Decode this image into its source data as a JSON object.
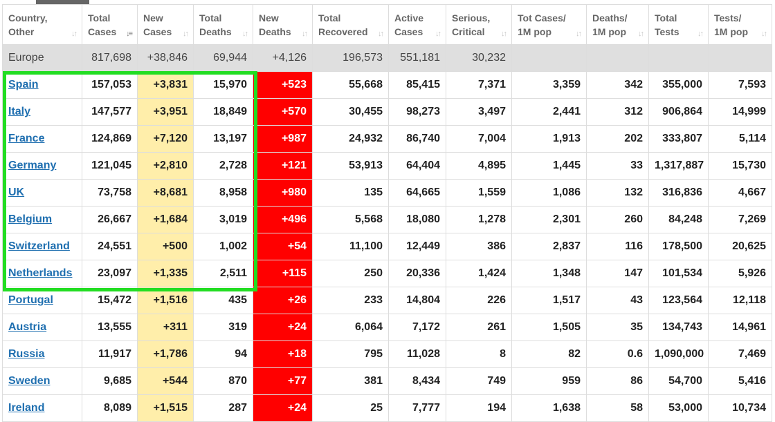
{
  "columns": [
    {
      "line1": "Country,",
      "line2": "Other",
      "sort_active": false
    },
    {
      "line1": "Total",
      "line2": "Cases",
      "sort_active": true
    },
    {
      "line1": "New",
      "line2": "Cases",
      "sort_active": false
    },
    {
      "line1": "Total",
      "line2": "Deaths",
      "sort_active": false
    },
    {
      "line1": "New",
      "line2": "Deaths",
      "sort_active": false
    },
    {
      "line1": "Total",
      "line2": "Recovered",
      "sort_active": false
    },
    {
      "line1": "Active",
      "line2": "Cases",
      "sort_active": false
    },
    {
      "line1": "Serious,",
      "line2": "Critical",
      "sort_active": false
    },
    {
      "line1": "Tot Cases/",
      "line2": "1M pop",
      "sort_active": false
    },
    {
      "line1": "Deaths/",
      "line2": "1M pop",
      "sort_active": false
    },
    {
      "line1": "Total",
      "line2": "Tests",
      "sort_active": false
    },
    {
      "line1": "Tests/",
      "line2": "1M pop",
      "sort_active": false
    }
  ],
  "continent_row": {
    "name": "Europe",
    "cells": [
      "817,698",
      "+38,846",
      "69,944",
      "+4,126",
      "196,573",
      "551,181",
      "30,232",
      "",
      "",
      "",
      ""
    ]
  },
  "rows": [
    {
      "name": "Spain",
      "cells": [
        "157,053",
        "+3,831",
        "15,970",
        "+523",
        "55,668",
        "85,415",
        "7,371",
        "3,359",
        "342",
        "355,000",
        "7,593"
      ]
    },
    {
      "name": "Italy",
      "cells": [
        "147,577",
        "+3,951",
        "18,849",
        "+570",
        "30,455",
        "98,273",
        "3,497",
        "2,441",
        "312",
        "906,864",
        "14,999"
      ]
    },
    {
      "name": "France",
      "cells": [
        "124,869",
        "+7,120",
        "13,197",
        "+987",
        "24,932",
        "86,740",
        "7,004",
        "1,913",
        "202",
        "333,807",
        "5,114"
      ]
    },
    {
      "name": "Germany",
      "cells": [
        "121,045",
        "+2,810",
        "2,728",
        "+121",
        "53,913",
        "64,404",
        "4,895",
        "1,445",
        "33",
        "1,317,887",
        "15,730"
      ]
    },
    {
      "name": "UK",
      "cells": [
        "73,758",
        "+8,681",
        "8,958",
        "+980",
        "135",
        "64,665",
        "1,559",
        "1,086",
        "132",
        "316,836",
        "4,667"
      ]
    },
    {
      "name": "Belgium",
      "cells": [
        "26,667",
        "+1,684",
        "3,019",
        "+496",
        "5,568",
        "18,080",
        "1,278",
        "2,301",
        "260",
        "84,248",
        "7,269"
      ]
    },
    {
      "name": "Switzerland",
      "cells": [
        "24,551",
        "+500",
        "1,002",
        "+54",
        "11,100",
        "12,449",
        "386",
        "2,837",
        "116",
        "178,500",
        "20,625"
      ]
    },
    {
      "name": "Netherlands",
      "cells": [
        "23,097",
        "+1,335",
        "2,511",
        "+115",
        "250",
        "20,336",
        "1,424",
        "1,348",
        "147",
        "101,534",
        "5,926"
      ]
    },
    {
      "name": "Portugal",
      "cells": [
        "15,472",
        "+1,516",
        "435",
        "+26",
        "233",
        "14,804",
        "226",
        "1,517",
        "43",
        "123,564",
        "12,118"
      ]
    },
    {
      "name": "Austria",
      "cells": [
        "13,555",
        "+311",
        "319",
        "+24",
        "6,064",
        "7,172",
        "261",
        "1,505",
        "35",
        "134,743",
        "14,961"
      ]
    },
    {
      "name": "Russia",
      "cells": [
        "11,917",
        "+1,786",
        "94",
        "+18",
        "795",
        "11,028",
        "8",
        "82",
        "0.6",
        "1,090,000",
        "7,469"
      ]
    },
    {
      "name": "Sweden",
      "cells": [
        "9,685",
        "+544",
        "870",
        "+77",
        "381",
        "8,434",
        "749",
        "959",
        "86",
        "54,700",
        "5,416"
      ]
    },
    {
      "name": "Ireland",
      "cells": [
        "8,089",
        "+1,515",
        "287",
        "+24",
        "25",
        "7,777",
        "194",
        "1,638",
        "58",
        "53,000",
        "10,734"
      ]
    }
  ],
  "colors": {
    "new_cases_bg": "#ffeeaa",
    "new_deaths_bg": "#ff0000",
    "highlight_border": "#22dd22",
    "link": "#1f6fb0"
  }
}
